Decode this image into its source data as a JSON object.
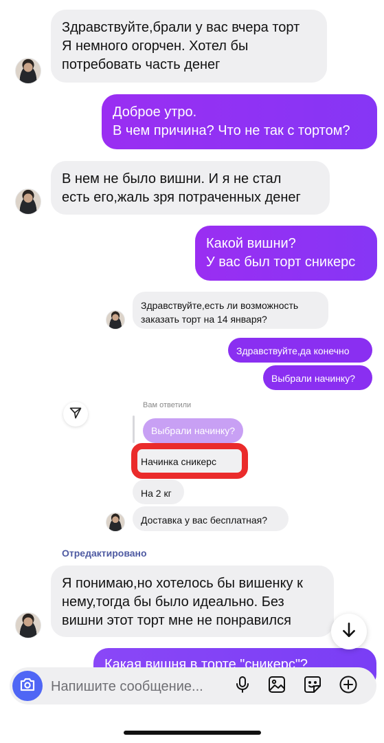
{
  "messages": {
    "m1": "Здравствуйте,брали у вас вчера торт\nЯ немного огорчен. Хотел бы\nпотребовать часть денег",
    "m2": "Доброе утро.\nВ чем причина? Что не так с тортом?",
    "m3": "В нем не было вишни. И я не стал\nесть его,жаль зря потраченных денег",
    "m4": "Какой вишни?\nУ вас был торт сникерс",
    "m5": "Здравствуйте,есть ли возможность\nзаказать торт на 14 января?",
    "m6": "Здравствуйте,да конечно",
    "m7": "Выбрали начинку?",
    "m8": "Начинка сникерс",
    "m9": "На 2 кг",
    "m10": "Доставка у вас бесплатная?",
    "m11": "Я понимаю,но хотелось бы вишенку к\nнему,тогда бы было идеально. Без\nвишни этот торт мне не понравился",
    "m12_partial": "Какая вишня в торте \"сникерс\"?"
  },
  "reply": {
    "label": "Вам ответили",
    "quote": "Выбрали начинку?"
  },
  "edited_label": "Отредактировано",
  "composer": {
    "placeholder": "Напишите сообщение..."
  },
  "icons": {
    "share": "send-arrow-icon",
    "scroll": "arrow-down-icon",
    "camera": "camera-icon",
    "mic": "microphone-icon",
    "gallery": "image-icon",
    "sticker": "sticker-icon",
    "more": "plus-circle-icon"
  },
  "colors": {
    "outgoing": "#8d2ff3",
    "incoming": "#efeff1",
    "accent_blue": "#4f66f5",
    "highlight_red": "#ea2b2b",
    "edited": "#4e5aa2"
  }
}
